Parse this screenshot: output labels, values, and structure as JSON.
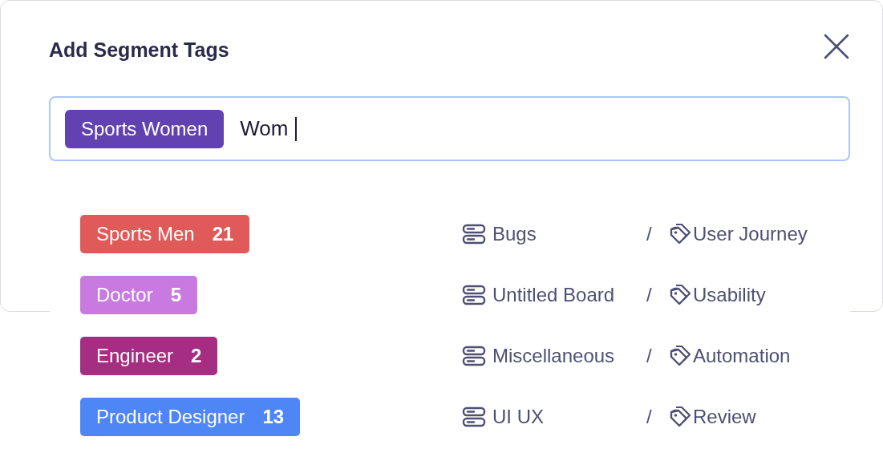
{
  "dialog": {
    "title": "Add Segment Tags"
  },
  "tag_input": {
    "focused": true,
    "value": "Wom",
    "chips": [
      {
        "label": "Sports Women",
        "color": "#6241b0"
      }
    ]
  },
  "suggestions": [
    {
      "label": "Sports Men",
      "count": "21",
      "color": "#e05a5a",
      "board": "Bugs",
      "separator": "/",
      "tag": "User Journey"
    },
    {
      "label": "Doctor",
      "count": "5",
      "color": "#c97ae0",
      "board": "Untitled Board",
      "separator": "/",
      "tag": "Usability"
    },
    {
      "label": "Engineer",
      "count": "2",
      "color": "#a52d82",
      "board": "Miscellaneous",
      "separator": "/",
      "tag": "Automation"
    },
    {
      "label": "Product Designer",
      "count": "13",
      "color": "#4f86f5",
      "board": "UI UX",
      "separator": "/",
      "tag": "Review"
    }
  ]
}
